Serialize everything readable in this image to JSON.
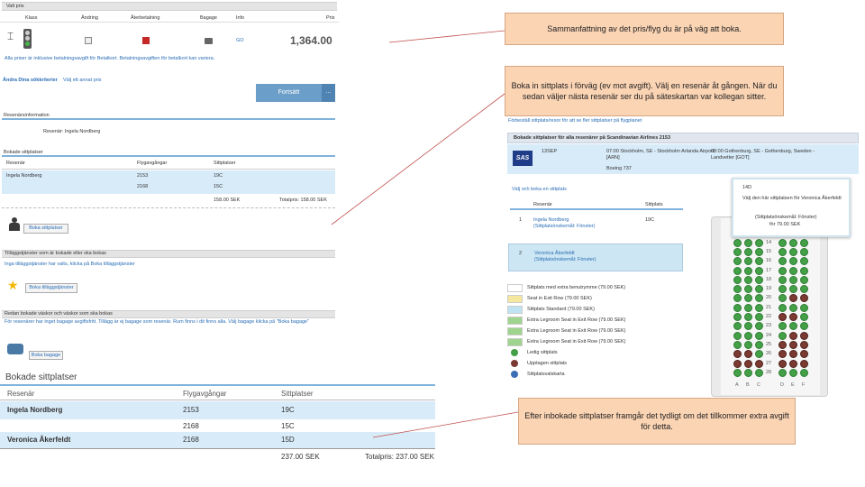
{
  "left_panel": {
    "top_bar": "Valt pris",
    "cols": [
      "Klass",
      "Ändring",
      "Återbetalning",
      "Bagage",
      "Info",
      "Pris"
    ],
    "info_link": "GO",
    "price": "1,364.00",
    "note_line": "Alla priser är inklusive betalningsavgift för Betalkort. Betalningsavgiften för betalkort kan variera.",
    "change_search": "Ändra Dina sökkriterier",
    "choose_other": "Välj ett annat pris",
    "continue_button": "Fortsätt",
    "more_button": "...",
    "traveller_header": "Resenärsinformation",
    "traveller_row": "Resenär: Ingela Nordberg",
    "booked_seats_header": "Bokade sittplatser",
    "seat_table_headers": [
      "Resenär",
      "Flygavgångar",
      "Sittplatser"
    ],
    "seat_rows": [
      {
        "name": "Ingela Nordberg",
        "flight": "2153",
        "seat": "19C"
      },
      {
        "name": "",
        "flight": "2168",
        "seat": "15C"
      }
    ],
    "seat_total": "158.00 SEK",
    "seat_total_label": "Totalpris: 158.00 SEK",
    "book_seats_button": "Boka sittplatser",
    "extra_header": "Tilläggstjänster som är bokade eller ska bokas",
    "extra_link": "Inga tilläggstjänster har valts, klicka på Boka tilläggstjänster",
    "extra_button": "Boka tilläggstjänster",
    "bags_header": "Redan bokade väskor och väskor som ska bokas",
    "bags_text": "För resenärer har inget bagage avgiftsfritt. Tillägg är ej bagage som resenär. Rum finns i dit finns alla. Välj bagage klicka på \"Boka bagage\"",
    "bags_button": "Boka bagage"
  },
  "zoom_table": {
    "title": "Bokade sittplatser",
    "headers": [
      "Resenär",
      "Flygavgångar",
      "Sittplatser"
    ],
    "rows": [
      {
        "name": "Ingela Nordberg",
        "flight": "2153",
        "seat": "19C"
      },
      {
        "name": "",
        "flight": "2168",
        "seat": "15C"
      },
      {
        "name": "Veronica Åkerfeldt",
        "flight": "2168",
        "seat": "15D"
      }
    ],
    "total": "237.00 SEK",
    "total_label": "Totalpris: 237.00 SEK"
  },
  "right_panel": {
    "intro": "Förbeställ sittplats/resor för att se fler sittplatser på flygplanet",
    "header": "Bokade sittplatser för alla resenärer på Scandinavian Airlines 2153",
    "airline_logo": "SAS",
    "flight_code": "13SEP",
    "flight_from": "07:00 Stockholm, SE - Stockholm Arlanda Airport [ARN]",
    "flight_to": "08:00 Gothenburg, SE - Gothenburg, Sweden - Landvetter [GOT]",
    "boeing": "Boeing 737",
    "choose_link": "Välj och boka en sittplats",
    "list_headers": [
      "Resenär",
      "Sittplats"
    ],
    "passengers": [
      {
        "num": "1",
        "name": "Ingela Nordberg",
        "pref": "(Sittplatsönskemål: Fönster)",
        "seat": "19C"
      },
      {
        "num": "2",
        "name": "Veronica Åkerfeldt",
        "pref": "(Sittplatsönskemål: Fönster)",
        "seat": ""
      }
    ],
    "legend": [
      {
        "label": "Sittplats med extra benutrymme (79.00 SEK)",
        "color": "#ffffff"
      },
      {
        "label": "Seat in Exit Row (79.00 SEK)",
        "color": "#f5e79e"
      },
      {
        "label": "Sittplats Standard (79.00 SEK)",
        "color": "#bfe3f3"
      },
      {
        "label": "Extra Legroom Seat in Exit Row (79.00 SEK)",
        "color": "#9ed48d"
      },
      {
        "label": "Extra Legroom Seat in Exit Row (79.00 SEK)",
        "color": "#9ed48d"
      },
      {
        "label": "Extra Legroom Seat in Exit Row (79.00 SEK)",
        "color": "#9ed48d"
      },
      {
        "label": "Ledig sittplats",
        "color": "#43a047"
      },
      {
        "label": "Upptagen sittplats",
        "color": "#7a3a32"
      },
      {
        "label": "Sittplatsvalskarta",
        "color": "#3b6fb5"
      }
    ],
    "tooltip_seat": "14D",
    "tooltip_text": "Välj den här sittplatsen för Veronica Åkerfeldt",
    "tooltip_extra": "(Sittplatsönskemål: Fönster)",
    "tooltip_price": "för 79.00 SEK",
    "row_numbers": [
      "12",
      "13",
      "14",
      "15",
      "16",
      "17",
      "18",
      "19",
      "20",
      "21",
      "22",
      "23",
      "24",
      "25",
      "26",
      "27",
      "28"
    ],
    "col_letters": [
      "A",
      "B",
      "C",
      "D",
      "E",
      "F"
    ]
  },
  "callouts": {
    "c1": "Sammanfattning av det pris/flyg du är på väg att boka.",
    "c2": "Boka in sittplats i förväg (ev mot avgift). Välj en resenär åt gången. När du sedan väljer nästa resenär ser du på säteskartan var kollegan sitter.",
    "c3": "Efter inbokade sittplatser framgår det tydligt om det tillkommer extra avgift för detta."
  },
  "colors": {
    "callout_bg": "#fbd4b4",
    "selected_row": "#d8ebf8",
    "accent_blue": "#2a6db5"
  }
}
